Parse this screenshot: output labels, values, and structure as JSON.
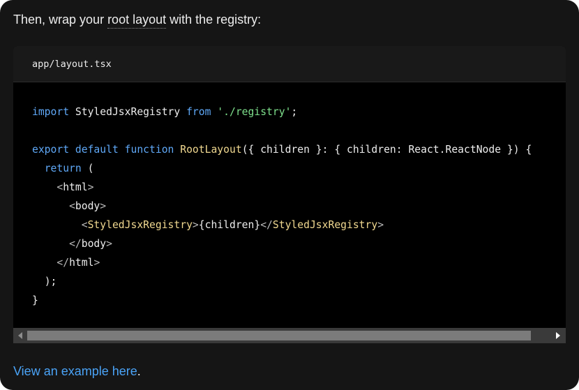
{
  "intro": {
    "before": "Then, wrap your ",
    "term": "root layout",
    "after": " with the registry:"
  },
  "code_block": {
    "filename": "app/layout.tsx",
    "lines": {
      "l1": {
        "t1": "import",
        "t2": " StyledJsxRegistry ",
        "t3": "from",
        "t4": " ",
        "t5": "'./registry'",
        "t6": ";"
      },
      "l3": {
        "t1": "export",
        "t2": " ",
        "t3": "default",
        "t4": " ",
        "t5": "function",
        "t6": " ",
        "t7": "RootLayout",
        "t8": "({ children }: { children: React.ReactNode }) {"
      },
      "l4": {
        "indent": "  ",
        "t1": "return",
        "t2": " ("
      },
      "l5": {
        "indent": "    ",
        "t1": "<",
        "t2": "html",
        "t3": ">"
      },
      "l6": {
        "indent": "      ",
        "t1": "<",
        "t2": "body",
        "t3": ">"
      },
      "l7": {
        "indent": "        ",
        "t1": "<",
        "t2": "StyledJsxRegistry",
        "t3": ">",
        "t4": "{children}",
        "t5": "</",
        "t6": "StyledJsxRegistry",
        "t7": ">"
      },
      "l8": {
        "indent": "      ",
        "t1": "</",
        "t2": "body",
        "t3": ">"
      },
      "l9": {
        "indent": "    ",
        "t1": "</",
        "t2": "html",
        "t3": ">"
      },
      "l10": {
        "indent": "  ",
        "t1": ");"
      },
      "l11": {
        "t1": "}"
      }
    }
  },
  "footer": {
    "link_text": "View an example here",
    "after": "."
  },
  "colors": {
    "background": "#151515",
    "code_background": "#000000",
    "keyword": "#5fa8f7",
    "function_name": "#f0d890",
    "string": "#7ee08c",
    "link": "#4aa3f7"
  },
  "icons": {
    "scroll_left": "scroll-left-arrow-icon",
    "scroll_right": "scroll-right-arrow-icon"
  }
}
